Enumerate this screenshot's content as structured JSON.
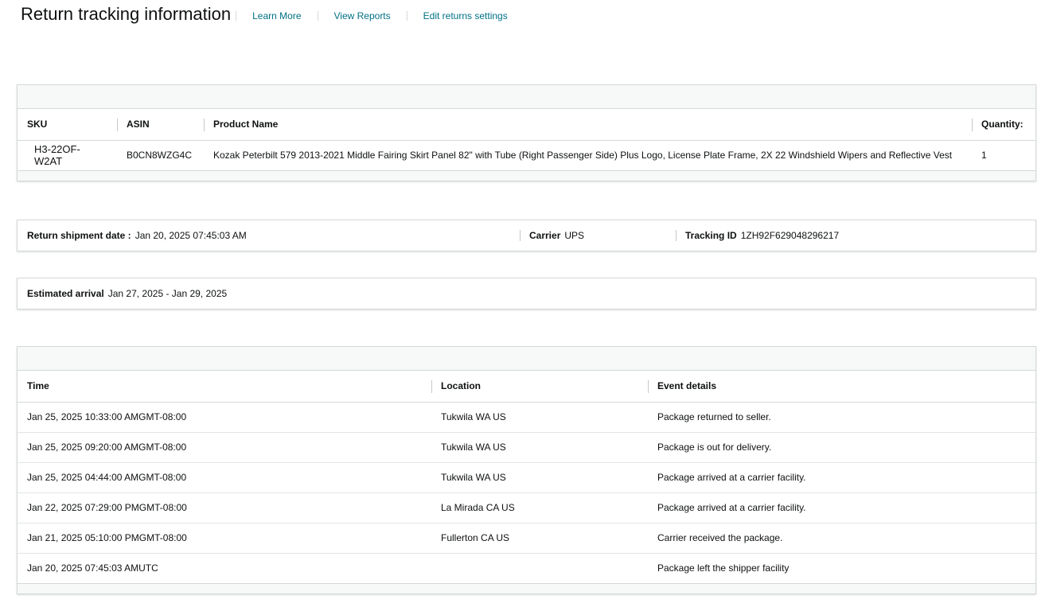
{
  "header": {
    "title": "Return tracking information",
    "links": [
      "Learn More",
      "View Reports",
      "Edit returns settings"
    ]
  },
  "product_table": {
    "columns": [
      "SKU",
      "ASIN",
      "Product Name",
      "Quantity:"
    ],
    "rows": [
      {
        "sku": "H3-22OF-W2AT",
        "asin": "B0CN8WZG4C",
        "product_name": "Kozak Peterbilt 579 2013-2021 Middle Fairing Skirt Panel 82\" with Tube (Right Passenger Side) Plus Logo, License Plate Frame, 2X 22 Windshield Wipers and Reflective Vest",
        "quantity": "1"
      }
    ]
  },
  "shipment": {
    "date_label": "Return shipment date :",
    "date_value": "Jan 20, 2025 07:45:03 AM",
    "carrier_label": "Carrier",
    "carrier_value": "UPS",
    "tracking_label": "Tracking ID",
    "tracking_value": "1ZH92F629048296217"
  },
  "arrival": {
    "label": "Estimated arrival",
    "value": "Jan 27, 2025 - Jan 29, 2025"
  },
  "events_table": {
    "columns": [
      "Time",
      "Location",
      "Event details"
    ],
    "rows": [
      {
        "time": "Jan 25, 2025 10:33:00 AMGMT-08:00",
        "location": "Tukwila WA US",
        "details": "Package returned to seller."
      },
      {
        "time": "Jan 25, 2025 09:20:00 AMGMT-08:00",
        "location": "Tukwila WA US",
        "details": "Package is out for delivery."
      },
      {
        "time": "Jan 25, 2025 04:44:00 AMGMT-08:00",
        "location": "Tukwila WA US",
        "details": "Package arrived at a carrier facility."
      },
      {
        "time": "Jan 22, 2025 07:29:00 PMGMT-08:00",
        "location": "La Mirada CA US",
        "details": "Package arrived at a carrier facility."
      },
      {
        "time": "Jan 21, 2025 05:10:00 PMGMT-08:00",
        "location": "Fullerton CA US",
        "details": "Carrier received the package."
      },
      {
        "time": "Jan 20, 2025 07:45:03 AMUTC",
        "location": "",
        "details": "Package left the shipper facility"
      }
    ]
  },
  "colors": {
    "link": "#007185",
    "text": "#0f1111",
    "border": "#d5d9d9",
    "band": "#f7f8f8"
  }
}
